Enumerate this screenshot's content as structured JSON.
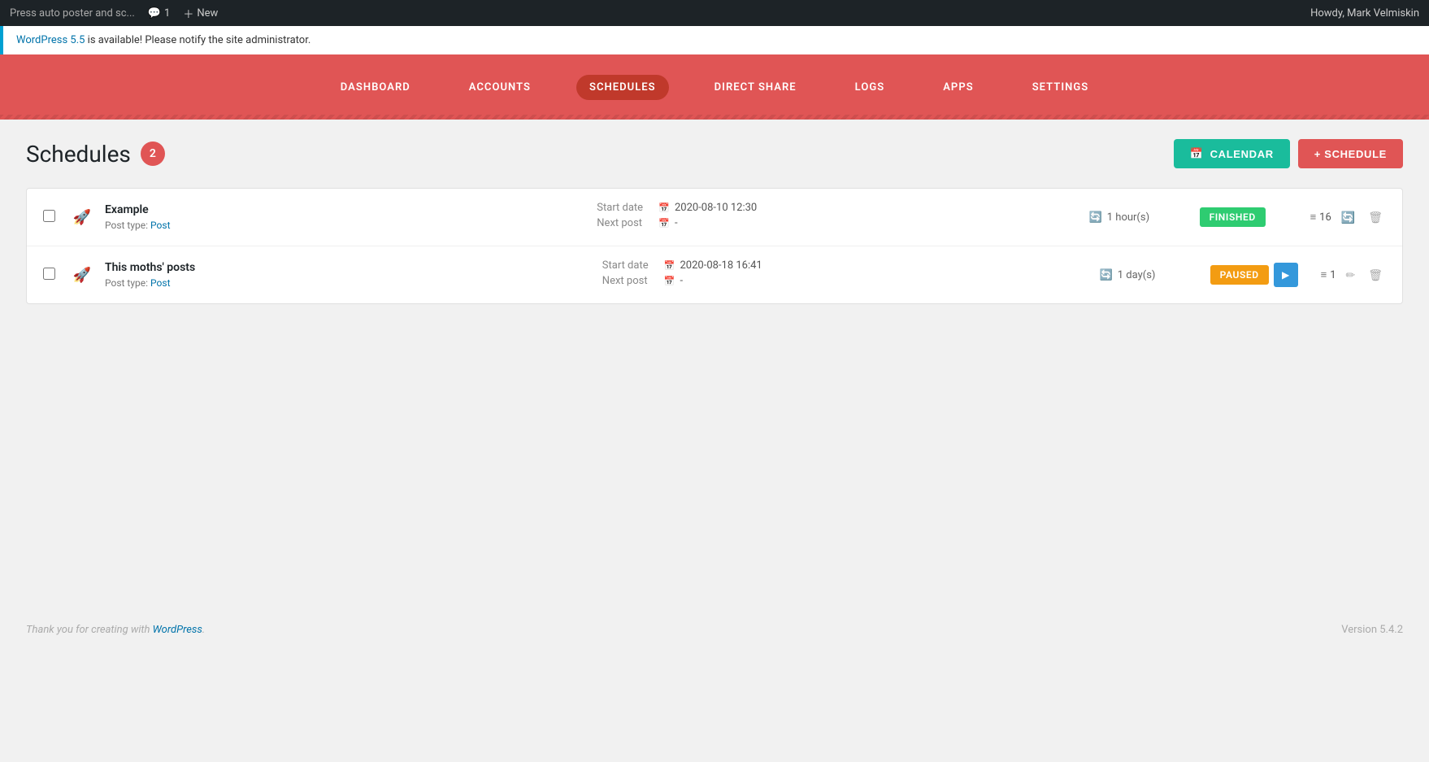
{
  "adminbar": {
    "title": "Press auto poster and sc...",
    "comments_label": "1",
    "new_label": "New",
    "user_label": "Howdy, Mark Velmiskin"
  },
  "notice": {
    "version_link": "WordPress 5.5",
    "message": " is available! Please notify the site administrator."
  },
  "nav": {
    "items": [
      {
        "id": "dashboard",
        "label": "DASHBOARD",
        "active": false
      },
      {
        "id": "accounts",
        "label": "ACCOUNTS",
        "active": false
      },
      {
        "id": "schedules",
        "label": "SCHEDULES",
        "active": true
      },
      {
        "id": "direct-share",
        "label": "DIRECT SHARE",
        "active": false
      },
      {
        "id": "logs",
        "label": "LOGS",
        "active": false
      },
      {
        "id": "apps",
        "label": "APPS",
        "active": false
      },
      {
        "id": "settings",
        "label": "SETTINGS",
        "active": false
      }
    ]
  },
  "page": {
    "title": "Schedules",
    "count": "2"
  },
  "buttons": {
    "calendar": "CALENDAR",
    "schedule": "+ SCHEDULE"
  },
  "schedules": [
    {
      "id": "row1",
      "name": "Example",
      "post_type_label": "Post type:",
      "post_type_link": "Post",
      "start_date_label": "Start date",
      "start_date": "2020-08-10 12:30",
      "next_post_label": "Next post",
      "next_post": "-",
      "interval": "1 hour(s)",
      "status": "FINISHED",
      "status_type": "finished",
      "list_count": "16",
      "has_play": false,
      "has_edit": false
    },
    {
      "id": "row2",
      "name": "This moths' posts",
      "post_type_label": "Post type:",
      "post_type_link": "Post",
      "start_date_label": "Start date",
      "start_date": "2020-08-18 16:41",
      "next_post_label": "Next post",
      "next_post": "-",
      "interval": "1 day(s)",
      "status": "PAUSED",
      "status_type": "paused",
      "list_count": "1",
      "has_play": true,
      "has_edit": true
    }
  ],
  "footer": {
    "thanks": "Thank you for creating with ",
    "wp_link": "WordPress",
    "version": "Version 5.4.2"
  }
}
